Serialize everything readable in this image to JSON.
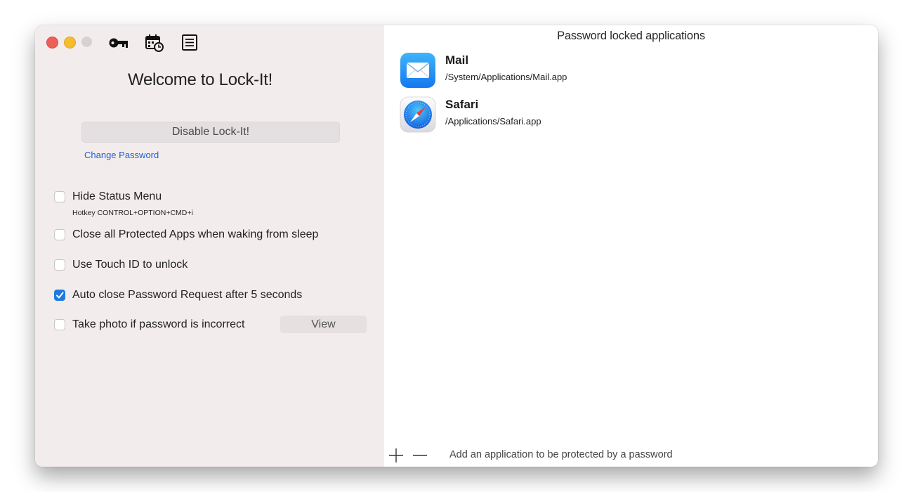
{
  "toolbar": {
    "icons": [
      "key-icon",
      "calendar-clock-icon",
      "list-icon"
    ]
  },
  "left": {
    "welcome_title": "Welcome to Lock-It!",
    "disable_button": "Disable Lock-It!",
    "change_password_link": "Change Password",
    "options": [
      {
        "label": "Hide Status Menu",
        "checked": false
      },
      {
        "label": "Close all Protected Apps when waking from sleep",
        "checked": false
      },
      {
        "label": "Use Touch ID to unlock",
        "checked": false
      },
      {
        "label": "Auto close Password Request after 5 seconds",
        "checked": true
      },
      {
        "label": "Take photo if password is incorrect",
        "checked": false
      }
    ],
    "hotkey_text": "Hotkey CONTROL+OPTION+CMD+i",
    "view_button": "View"
  },
  "right": {
    "title": "Password locked applications",
    "apps": [
      {
        "name": "Mail",
        "path": "/System/Applications/Mail.app",
        "icon": "mail-app-icon"
      },
      {
        "name": "Safari",
        "path": "/Applications/Safari.app",
        "icon": "safari-app-icon"
      }
    ],
    "footer_text": "Add an application to be protected by a password"
  },
  "colors": {
    "accent": "#1f7ae0",
    "link": "#1f5fd1",
    "sidebar_bg": "#f3eced",
    "close": "#ee5f58",
    "minimize": "#f6bd2f",
    "zoom_inactive": "#d6d1d2"
  }
}
